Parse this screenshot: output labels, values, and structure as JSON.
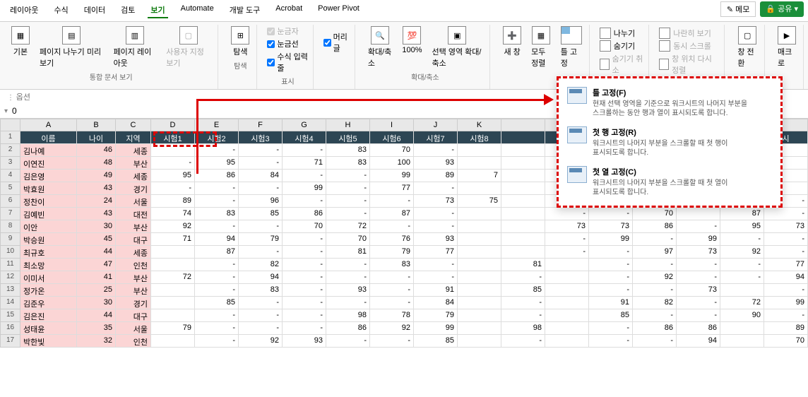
{
  "topbar": {
    "memo": "메모",
    "share": "공유"
  },
  "menus": [
    "레이아웃",
    "수식",
    "데이터",
    "검토",
    "보기",
    "Automate",
    "개발 도구",
    "Acrobat",
    "Power Pivot"
  ],
  "ribbon": {
    "group1": {
      "label": "통합 문서 보기",
      "items": [
        "기본",
        "페이지 나누기 미리 보기",
        "페이지 레이아웃",
        "사용자 지정 보기"
      ]
    },
    "group2": {
      "label": "탐색",
      "item": "탐색"
    },
    "group3": {
      "label": "표시",
      "opts": [
        "눈금자",
        "머리글",
        "눈금선",
        "수식 입력줄"
      ]
    },
    "group4": {
      "label": "확대/축소",
      "items": [
        "확대/축소",
        "100%",
        "선택 영역 확대/축소"
      ]
    },
    "group5": {
      "items": [
        "새 창",
        "모두 정렬",
        "틀 고정"
      ],
      "side": [
        "나누기",
        "숨기기",
        "숨기기 취소"
      ],
      "side2": [
        "나란히 보기",
        "동시 스크롤",
        "창 위치 다시 정렬"
      ],
      "switch": "창 전환",
      "macro": "매크로"
    }
  },
  "options": "옵션",
  "formula": "0",
  "cols": [
    "A",
    "B",
    "C",
    "D",
    "E",
    "F",
    "G",
    "H",
    "I",
    "J",
    "K",
    "",
    "",
    "",
    "",
    "",
    "",
    ""
  ],
  "hdrRow": [
    "이름",
    "나이",
    "지역",
    "시험1",
    "시험2",
    "시험3",
    "시험4",
    "시험5",
    "시험6",
    "시험7",
    "시험8",
    "",
    "",
    "",
    "",
    "",
    "",
    "시"
  ],
  "rows": [
    {
      "n": 2,
      "c": [
        "김나예",
        "46",
        "세종",
        "",
        "-",
        "-",
        "-",
        "83",
        "70",
        "-",
        "",
        "",
        "",
        "",
        "",
        "",
        "",
        ""
      ]
    },
    {
      "n": 3,
      "c": [
        "이연진",
        "48",
        "부산",
        "-",
        "95",
        "-",
        "71",
        "83",
        "100",
        "93",
        "",
        "",
        "",
        "",
        "",
        "",
        "",
        ""
      ]
    },
    {
      "n": 4,
      "c": [
        "김은영",
        "49",
        "세종",
        "95",
        "86",
        "84",
        "-",
        "-",
        "99",
        "89",
        "7",
        "",
        "",
        "9",
        "",
        "",
        "7",
        ""
      ]
    },
    {
      "n": 5,
      "c": [
        "박효원",
        "43",
        "경기",
        "-",
        "-",
        "-",
        "99",
        "-",
        "77",
        "-",
        "",
        "",
        "-",
        "",
        "-",
        "",
        "-",
        ""
      ]
    },
    {
      "n": 6,
      "c": [
        "정찬이",
        "24",
        "서울",
        "89",
        "-",
        "96",
        "-",
        "-",
        "-",
        "73",
        "75",
        "",
        "-",
        "74",
        "-",
        "",
        "95",
        "-"
      ]
    },
    {
      "n": 7,
      "c": [
        "김예빈",
        "43",
        "대전",
        "74",
        "83",
        "85",
        "86",
        "-",
        "87",
        "-",
        "",
        "",
        "-",
        "-",
        "70",
        "",
        "87",
        "-"
      ]
    },
    {
      "n": 8,
      "c": [
        "이안",
        "30",
        "부산",
        "92",
        "-",
        "-",
        "70",
        "72",
        "-",
        "-",
        "",
        "",
        "73",
        "73",
        "86",
        "-",
        "95",
        "73"
      ]
    },
    {
      "n": 9,
      "c": [
        "박승원",
        "45",
        "대구",
        "71",
        "94",
        "79",
        "-",
        "70",
        "76",
        "93",
        "",
        "",
        "-",
        "99",
        "-",
        "99",
        "-",
        "-"
      ]
    },
    {
      "n": 10,
      "c": [
        "최규호",
        "44",
        "세종",
        "",
        "87",
        "-",
        "-",
        "81",
        "79",
        "77",
        "",
        "",
        "-",
        "-",
        "97",
        "73",
        "92",
        "-"
      ]
    },
    {
      "n": 11,
      "c": [
        "최소망",
        "47",
        "인천",
        "",
        "-",
        "82",
        "-",
        "-",
        "83",
        "-",
        "",
        "81",
        "",
        "-",
        "-",
        "-",
        "-",
        "77"
      ]
    },
    {
      "n": 12,
      "c": [
        "이미서",
        "41",
        "부산",
        "72",
        "-",
        "94",
        "-",
        "-",
        "-",
        "-",
        "",
        "-",
        "",
        "-",
        "92",
        "-",
        "-",
        "94"
      ]
    },
    {
      "n": 13,
      "c": [
        "정가온",
        "25",
        "부산",
        "",
        "-",
        "83",
        "-",
        "93",
        "-",
        "91",
        "",
        "85",
        "",
        "-",
        "-",
        "73",
        "",
        "-"
      ]
    },
    {
      "n": 14,
      "c": [
        "김준우",
        "30",
        "경기",
        "",
        "85",
        "-",
        "-",
        "-",
        "-",
        "84",
        "",
        "-",
        "",
        "91",
        "82",
        "-",
        "72",
        "99"
      ]
    },
    {
      "n": 15,
      "c": [
        "김은진",
        "44",
        "대구",
        "",
        "-",
        "-",
        "-",
        "98",
        "78",
        "79",
        "",
        "-",
        "",
        "85",
        "-",
        "-",
        "90",
        "-"
      ]
    },
    {
      "n": 16,
      "c": [
        "성태윤",
        "35",
        "서울",
        "79",
        "-",
        "-",
        "-",
        "86",
        "92",
        "99",
        "",
        "98",
        "",
        "-",
        "86",
        "86",
        "",
        "89"
      ]
    },
    {
      "n": 17,
      "c": [
        "박한빛",
        "32",
        "인천",
        "",
        "-",
        "92",
        "93",
        "-",
        "-",
        "85",
        "",
        "-",
        "",
        "-",
        "-",
        "94",
        "",
        "70"
      ]
    }
  ],
  "popup": {
    "t1": "틀 고정(F)",
    "d1a": "현재 선택 영역을 기준으로 워크시트의 나머지 부분을",
    "d1b": "스크롤하는 동안 행과 열이 표시되도록 합니다.",
    "t2": "첫 행 고정(R)",
    "d2a": "워크시트의 나머지 부분을 스크롤할 때 첫 행이",
    "d2b": "표시되도록 합니다.",
    "t3": "첫 열 고정(C)",
    "d3a": "워크시트의 나머지 부분을 스크롤할 때 첫 열이",
    "d3b": "표시되도록 합니다."
  },
  "chart_data": null
}
